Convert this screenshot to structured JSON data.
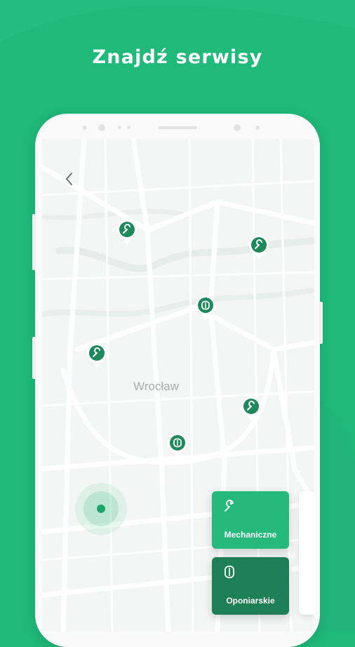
{
  "headline": "Znajdź serwisy",
  "map": {
    "city_label": "Wrocław",
    "pins": [
      {
        "type": "wrench-icon"
      },
      {
        "type": "wrench-icon"
      },
      {
        "type": "tire-icon"
      },
      {
        "type": "wrench-icon"
      },
      {
        "type": "wrench-icon"
      },
      {
        "type": "tire-icon"
      }
    ]
  },
  "categories": [
    {
      "label": "Mechaniczne",
      "icon": "wrench-icon"
    },
    {
      "label": "Oponiarskie",
      "icon": "tire-icon"
    }
  ],
  "colors": {
    "brand_green": "#1fb979",
    "pin_green": "#1e8a5b",
    "card_dark": "#1d7f55",
    "card_light": "#25b97c"
  }
}
